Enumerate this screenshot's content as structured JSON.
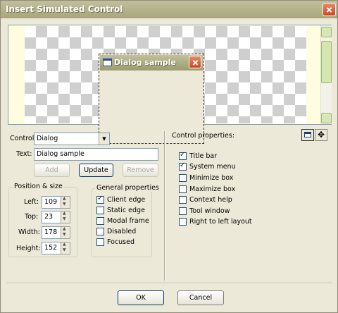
{
  "window": {
    "title": "Insert Simulated Control"
  },
  "preview": {
    "dialog_title": "Dialog sample"
  },
  "control_row": {
    "label": "Control:",
    "selected": "Dialog"
  },
  "text_row": {
    "label": "Text:",
    "value": "Dialog sample"
  },
  "buttons": {
    "add": "Add",
    "update": "Update",
    "remove": "Remove"
  },
  "position_size": {
    "title": "Position & size",
    "left_label": "Left:",
    "left_value": "109",
    "top_label": "Top:",
    "top_value": "23",
    "width_label": "Width:",
    "width_value": "178",
    "height_label": "Height:",
    "height_value": "152"
  },
  "general_properties": {
    "title": "General properties",
    "items": [
      {
        "label": "Client edge",
        "checked": true
      },
      {
        "label": "Static edge",
        "checked": false
      },
      {
        "label": "Modal frame",
        "checked": false
      },
      {
        "label": "Disabled",
        "checked": false
      },
      {
        "label": "Focused",
        "checked": false
      }
    ]
  },
  "control_properties": {
    "title": "Control properties:",
    "items": [
      {
        "label": "Title bar",
        "checked": true
      },
      {
        "label": "System menu",
        "checked": true
      },
      {
        "label": "Minimize box",
        "checked": false
      },
      {
        "label": "Maximize box",
        "checked": false
      },
      {
        "label": "Context help",
        "checked": false
      },
      {
        "label": "Tool window",
        "checked": false
      },
      {
        "label": "Right to left layout",
        "checked": false
      }
    ]
  },
  "footer": {
    "ok": "OK",
    "cancel": "Cancel"
  }
}
